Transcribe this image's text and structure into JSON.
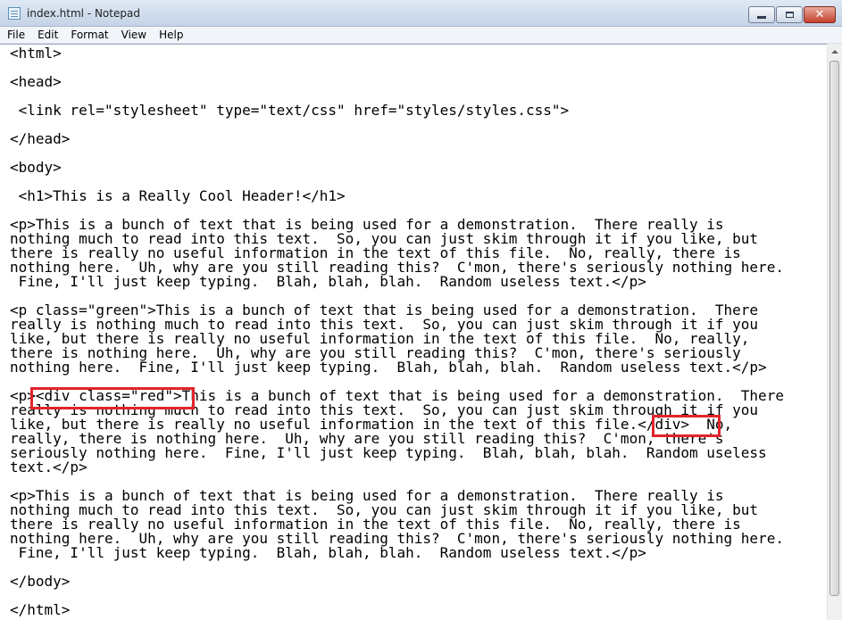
{
  "window": {
    "title": "index.html - Notepad",
    "app_icon": "notepad-icon",
    "controls": {
      "minimize_icon": "minimize-icon",
      "maximize_icon": "maximize-icon",
      "close_glyph": "✕"
    }
  },
  "menu": {
    "items": [
      "File",
      "Edit",
      "Format",
      "View",
      "Help"
    ]
  },
  "editor": {
    "content": "<html>\n\n<head>\n\n <link rel=\"stylesheet\" type=\"text/css\" href=\"styles/styles.css\">\n\n</head>\n\n<body>\n\n <h1>This is a Really Cool Header!</h1>\n\n<p>This is a bunch of text that is being used for a demonstration.  There really is\nnothing much to read into this text.  So, you can just skim through it if you like, but\nthere is really no useful information in the text of this file.  No, really, there is\nnothing here.  Uh, why are you still reading this?  C'mon, there's seriously nothing here.\n Fine, I'll just keep typing.  Blah, blah, blah.  Random useless text.</p>\n\n<p class=\"green\">This is a bunch of text that is being used for a demonstration.  There\nreally is nothing much to read into this text.  So, you can just skim through it if you\nlike, but there is really no useful information in the text of this file.  No, really,\nthere is nothing here.  Uh, why are you still reading this?  C'mon, there's seriously\nnothing here.  Fine, I'll just keep typing.  Blah, blah, blah.  Random useless text.</p>\n\n<p><div class=\"red\">This is a bunch of text that is being used for a demonstration.  There\nreally is nothing much to read into this text.  So, you can just skim through it if you\nlike, but there is really no useful information in the text of this file.</div>  No,\nreally, there is nothing here.  Uh, why are you still reading this?  C'mon, there's\nseriously nothing here.  Fine, I'll just keep typing.  Blah, blah, blah.  Random useless\ntext.</p>\n\n<p>This is a bunch of text that is being used for a demonstration.  There really is\nnothing much to read into this text.  So, you can just skim through it if you like, but\nthere is really no useful information in the text of this file.  No, really, there is\nnothing here.  Uh, why are you still reading this?  C'mon, there's seriously nothing here.\n Fine, I'll just keep typing.  Blah, blah, blah.  Random useless text.</p>\n\n</body>\n\n</html>"
  },
  "annotations": {
    "highlight_color": "#e3242b"
  }
}
